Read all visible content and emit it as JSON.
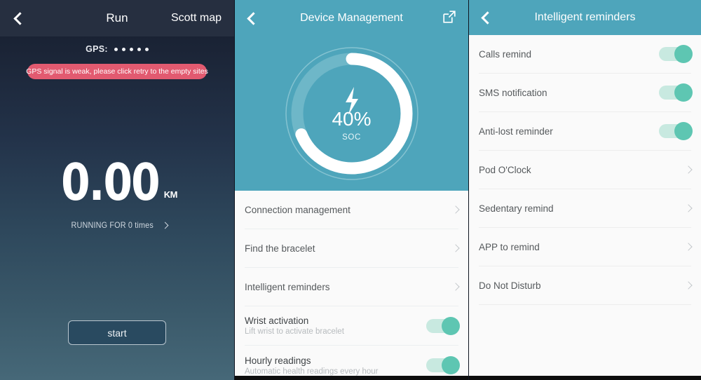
{
  "run_screen": {
    "header": {
      "back_icon": "back-chevron-icon",
      "title": "Run",
      "map_link": "Scott map"
    },
    "gps": {
      "label": "GPS:",
      "signal_dots": 5,
      "warning": "GPS signal is weak, please click retry to the empty sites",
      "warning_color": "#e25a70"
    },
    "distance": {
      "value": "0.00",
      "unit": "KM"
    },
    "run_count": {
      "text": "RUNNING FOR 0 times",
      "chevron_icon": "chevron-right-icon"
    },
    "start_button": "start"
  },
  "device_screen": {
    "header": {
      "back_icon": "back-chevron-icon",
      "title": "Device Management",
      "share_icon": "external-link-icon"
    },
    "battery": {
      "percent_label": "40%",
      "percent_value": 40,
      "caption": "SOC",
      "charging_icon": "lightning-bolt-icon",
      "arc_color": "#ffffff",
      "track_color": "#8fc8d5",
      "background_color": "#4ea5bb"
    },
    "items": [
      {
        "label": "Connection management",
        "type": "link"
      },
      {
        "label": "Find the bracelet",
        "type": "link"
      },
      {
        "label": "Intelligent reminders",
        "type": "link"
      },
      {
        "label": "Wrist activation",
        "subtitle": "Lift wrist to activate bracelet",
        "type": "toggle",
        "on": true
      },
      {
        "label": "Hourly readings",
        "subtitle": "Automatic health readings every hour",
        "type": "toggle",
        "on": true
      }
    ]
  },
  "reminders_screen": {
    "header": {
      "back_icon": "back-chevron-icon",
      "title": "Intelligent reminders"
    },
    "items": [
      {
        "label": "Calls remind",
        "type": "toggle",
        "on": true
      },
      {
        "label": "SMS notification",
        "type": "toggle",
        "on": true
      },
      {
        "label": "Anti-lost reminder",
        "type": "toggle",
        "on": true
      },
      {
        "label": "Pod O'Clock",
        "type": "link"
      },
      {
        "label": "Sedentary remind",
        "type": "link"
      },
      {
        "label": "APP to remind",
        "type": "link"
      },
      {
        "label": "Do Not Disturb",
        "type": "link"
      }
    ]
  },
  "theme": {
    "teal": "#4ea5bb",
    "toggle_on_knob": "#5ec6b2",
    "toggle_on_track": "#c8e9e0",
    "alert_pink": "#e25a70"
  }
}
